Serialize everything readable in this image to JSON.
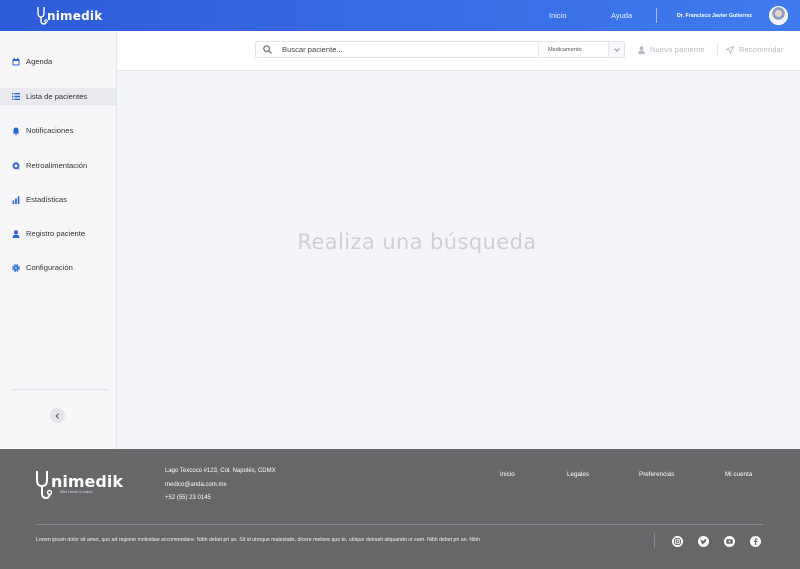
{
  "app": {
    "brand": "nimedik",
    "tagline": "Mini Home tu salud"
  },
  "topbar": {
    "nav": [
      "Inicio",
      "Ayuda"
    ],
    "user_name": "Dr. Francisco Javier Gutierrez"
  },
  "sidebar": {
    "items": [
      {
        "label": "Agenda",
        "icon": "calendar-icon"
      },
      {
        "label": "Lista de pacientes",
        "icon": "list-icon",
        "active": true
      },
      {
        "label": "Notificaciones",
        "icon": "bell-icon"
      },
      {
        "label": "Retroalimentación",
        "icon": "chat-icon"
      },
      {
        "label": "Estadísticas",
        "icon": "bar-chart-icon"
      },
      {
        "label": "Registro paciente",
        "icon": "user-icon"
      },
      {
        "label": "Configuración",
        "icon": "gear-icon"
      }
    ],
    "collapse_icon": "chevron-left-icon"
  },
  "toolbar": {
    "search_placeholder": "Buscar paciente...",
    "filter_value": "Medicamento",
    "new_patient": "Nuevo paciente",
    "recommend": "Recomendar"
  },
  "main": {
    "empty_message": "Realiza una búsqueda"
  },
  "footer": {
    "address": "Lago Texcoco #123, Col. Napolés, CDMX",
    "email": "medico@anda.com.mx",
    "phone": "+52 (55) 23 0145",
    "links": [
      "Inicio",
      "Legales",
      "Preferencias",
      "Mi cuenta"
    ],
    "lorem": "Lorem ipsum dolor sit amet, quo ad regione molestiae accommodare. Nibh debet pri an. Sit id utroque maiestatis, dicere meliore quo te, ubique detraxit aliquando ut eam. Nibh debet pri an. Nibh",
    "social": [
      "instagram-icon",
      "twitter-icon",
      "youtube-icon",
      "facebook-icon"
    ]
  },
  "colors": {
    "primary": "#3a6ee6",
    "footer": "#666769",
    "sidebar_icon": "#2f63d9"
  }
}
